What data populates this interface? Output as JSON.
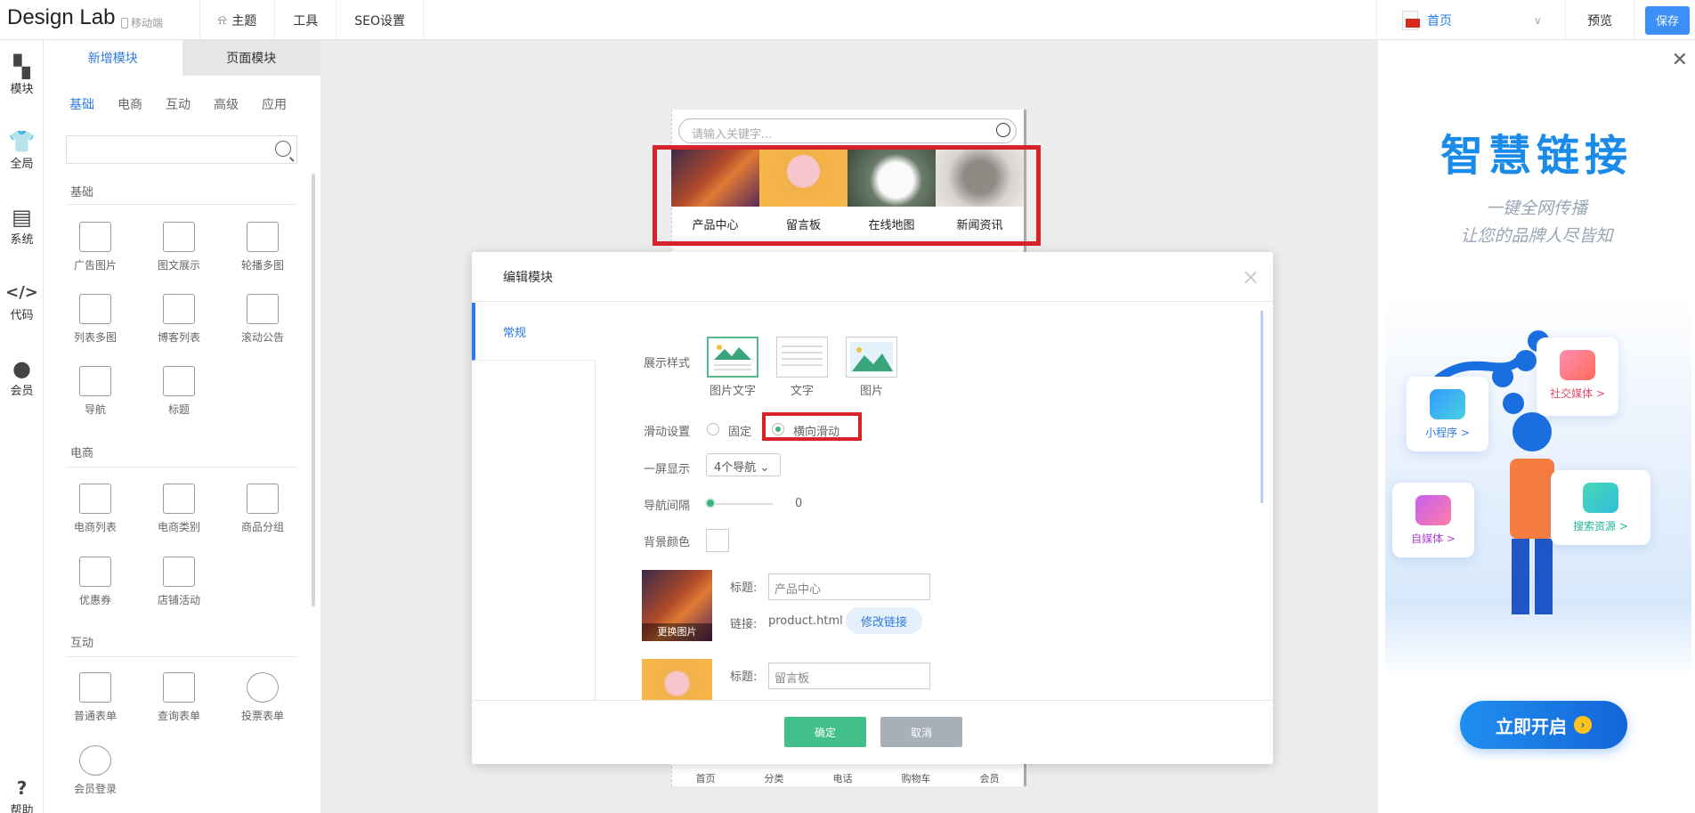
{
  "app": {
    "logo": "Design Lab",
    "mobile_label": "移动端"
  },
  "topnav": [
    {
      "label": "主题"
    },
    {
      "label": "工具"
    },
    {
      "label": "SEO设置"
    }
  ],
  "topright": {
    "page_select": "首页",
    "preview": "预览",
    "save": "保存"
  },
  "rail": [
    {
      "label": "模块",
      "icon": "grid-icon"
    },
    {
      "label": "全局",
      "icon": "shirt-icon"
    },
    {
      "label": "系统",
      "icon": "document-icon"
    },
    {
      "label": "代码",
      "icon": "code-icon"
    },
    {
      "label": "会员",
      "icon": "user-icon"
    },
    {
      "label": "帮助",
      "icon": "help-icon"
    }
  ],
  "panel": {
    "tabs": [
      "新增模块",
      "页面模块"
    ],
    "subtabs": [
      "基础",
      "电商",
      "互动",
      "高级",
      "应用"
    ],
    "sections": {
      "basic": {
        "title": "基础",
        "items": [
          "广告图片",
          "图文展示",
          "轮播多图",
          "列表多图",
          "博客列表",
          "滚动公告",
          "导航",
          "标题"
        ]
      },
      "ecom": {
        "title": "电商",
        "items": [
          "电商列表",
          "电商类别",
          "商品分组",
          "优惠券",
          "店铺活动"
        ]
      },
      "interact": {
        "title": "互动",
        "items": [
          "普通表单",
          "查询表单",
          "投票表单",
          "会员登录"
        ]
      }
    }
  },
  "preview": {
    "search_placeholder": "请输入关键字...",
    "nav_items": [
      "产品中心",
      "留言板",
      "在线地图",
      "新闻资讯"
    ],
    "bottom_nav": [
      "首页",
      "分类",
      "电话",
      "购物车",
      "会员"
    ]
  },
  "modal": {
    "title": "编辑模块",
    "left_tab": "常规",
    "display_style_label": "展示样式",
    "styles": [
      "图片文字",
      "文字",
      "图片"
    ],
    "scroll_label": "滑动设置",
    "scroll_options": [
      "固定",
      "横向滑动"
    ],
    "per_screen_label": "一屏显示",
    "per_screen_value": "4个导航",
    "gap_label": "导航间隔",
    "gap_value": "0",
    "bg_label": "背景颜色",
    "item1": {
      "replace_img": "更换图片",
      "title_label": "标题:",
      "title_value": "产品中心",
      "link_label": "链接:",
      "link_value": "product.html",
      "edit_link": "修改链接"
    },
    "item2": {
      "title_label": "标题:",
      "title_value": "留言板"
    },
    "ok": "确定",
    "cancel": "取消"
  },
  "ad": {
    "title": "智慧链接",
    "sub1": "一键全网传播",
    "sub2": "让您的品牌人尽皆知",
    "cards": [
      "社交媒体 >",
      "小程序 >",
      "自媒体 >",
      "搜索资源 >"
    ],
    "button": "立即开启"
  },
  "colors": {
    "accent": "#2d7be5",
    "green": "#43c08a",
    "highlight": "#d8232a"
  }
}
